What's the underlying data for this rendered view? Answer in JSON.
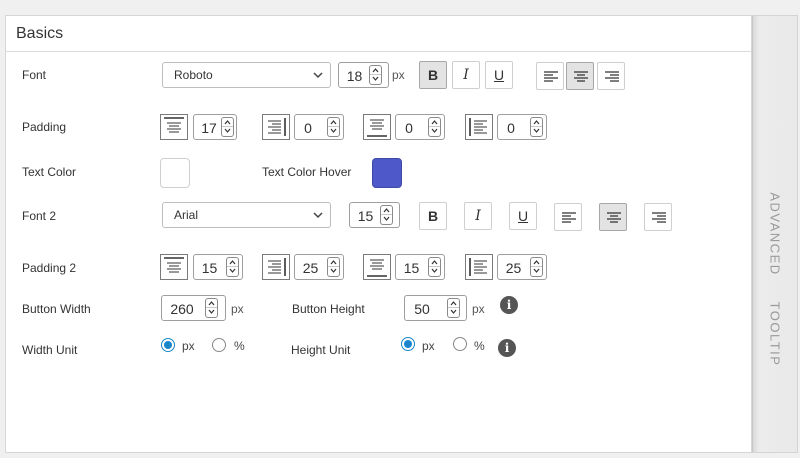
{
  "panel": {
    "title": "Basics"
  },
  "side_tabs": {
    "advanced": "ADVANCED",
    "tooltip": "TOOLTIP"
  },
  "font": {
    "label": "Font",
    "family": "Roboto",
    "size": "18",
    "size_unit": "px",
    "bold": "B",
    "italic": "I",
    "underline": "U",
    "align_active": "center"
  },
  "padding": {
    "label": "Padding",
    "top": "17",
    "right": "0",
    "bottom": "0",
    "left": "0"
  },
  "text_color": {
    "label": "Text Color",
    "value": "#ffffff"
  },
  "text_color_hover": {
    "label": "Text Color Hover",
    "value": "#4f58c9"
  },
  "font2": {
    "label": "Font 2",
    "family": "Arial",
    "size": "15",
    "bold": "B",
    "italic": "I",
    "underline": "U",
    "align_active": "center"
  },
  "padding2": {
    "label": "Padding 2",
    "top": "15",
    "right": "25",
    "bottom": "15",
    "left": "25"
  },
  "button_width": {
    "label": "Button Width",
    "value": "260",
    "unit": "px"
  },
  "button_height": {
    "label": "Button Height",
    "value": "50",
    "unit": "px"
  },
  "width_unit": {
    "label": "Width Unit",
    "options": [
      "px",
      "%"
    ],
    "selected": "px"
  },
  "height_unit": {
    "label": "Height Unit",
    "options": [
      "px",
      "%"
    ],
    "selected": "px"
  },
  "info_glyph": "i"
}
